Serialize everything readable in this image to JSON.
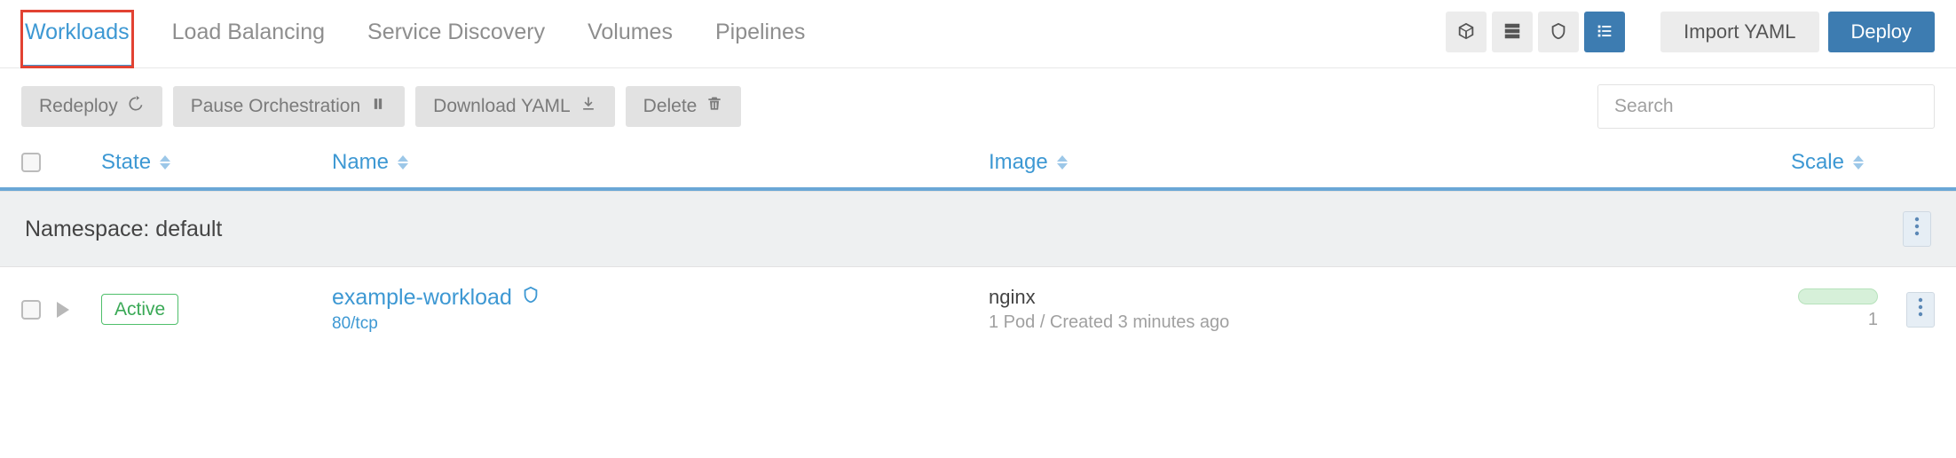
{
  "tabs": {
    "workloads": "Workloads",
    "load_balancing": "Load Balancing",
    "service_discovery": "Service Discovery",
    "volumes": "Volumes",
    "pipelines": "Pipelines"
  },
  "topbar": {
    "import_yaml": "Import YAML",
    "deploy": "Deploy"
  },
  "actions": {
    "redeploy": "Redeploy",
    "pause": "Pause Orchestration",
    "download": "Download YAML",
    "delete": "Delete",
    "search_placeholder": "Search"
  },
  "columns": {
    "state": "State",
    "name": "Name",
    "image": "Image",
    "scale": "Scale"
  },
  "namespace": {
    "label": "Namespace: default"
  },
  "rows": [
    {
      "state": "Active",
      "name": "example-workload",
      "port": "80/tcp",
      "image": "nginx",
      "meta": "1 Pod / Created 3 minutes ago",
      "scale": "1"
    }
  ]
}
